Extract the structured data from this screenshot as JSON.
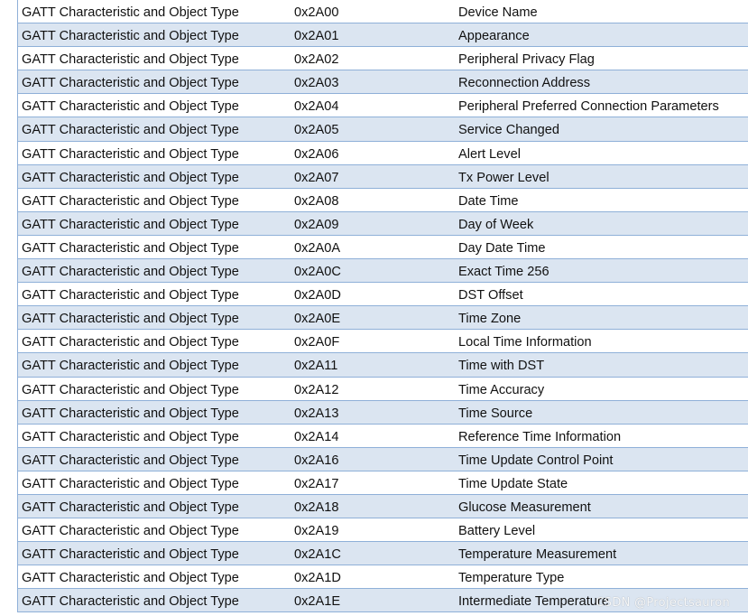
{
  "table": {
    "rows": [
      {
        "type": "GATT Characteristic and Object Type",
        "uuid": "0x2A00",
        "name": "Device Name"
      },
      {
        "type": "GATT Characteristic and Object Type",
        "uuid": "0x2A01",
        "name": "Appearance"
      },
      {
        "type": "GATT Characteristic and Object Type",
        "uuid": "0x2A02",
        "name": "Peripheral Privacy Flag"
      },
      {
        "type": "GATT Characteristic and Object Type",
        "uuid": "0x2A03",
        "name": "Reconnection Address"
      },
      {
        "type": "GATT Characteristic and Object Type",
        "uuid": "0x2A04",
        "name": "Peripheral Preferred Connection Parameters"
      },
      {
        "type": "GATT Characteristic and Object Type",
        "uuid": "0x2A05",
        "name": "Service Changed"
      },
      {
        "type": "GATT Characteristic and Object Type",
        "uuid": "0x2A06",
        "name": "Alert Level"
      },
      {
        "type": "GATT Characteristic and Object Type",
        "uuid": "0x2A07",
        "name": "Tx Power Level"
      },
      {
        "type": "GATT Characteristic and Object Type",
        "uuid": "0x2A08",
        "name": "Date Time"
      },
      {
        "type": "GATT Characteristic and Object Type",
        "uuid": "0x2A09",
        "name": "Day of Week"
      },
      {
        "type": "GATT Characteristic and Object Type",
        "uuid": "0x2A0A",
        "name": "Day Date Time"
      },
      {
        "type": "GATT Characteristic and Object Type",
        "uuid": "0x2A0C",
        "name": "Exact Time 256"
      },
      {
        "type": "GATT Characteristic and Object Type",
        "uuid": "0x2A0D",
        "name": "DST Offset"
      },
      {
        "type": "GATT Characteristic and Object Type",
        "uuid": "0x2A0E",
        "name": "Time Zone"
      },
      {
        "type": "GATT Characteristic and Object Type",
        "uuid": "0x2A0F",
        "name": "Local Time Information"
      },
      {
        "type": "GATT Characteristic and Object Type",
        "uuid": "0x2A11",
        "name": "Time with DST"
      },
      {
        "type": "GATT Characteristic and Object Type",
        "uuid": "0x2A12",
        "name": "Time Accuracy"
      },
      {
        "type": "GATT Characteristic and Object Type",
        "uuid": "0x2A13",
        "name": "Time Source"
      },
      {
        "type": "GATT Characteristic and Object Type",
        "uuid": "0x2A14",
        "name": "Reference Time Information"
      },
      {
        "type": "GATT Characteristic and Object Type",
        "uuid": "0x2A16",
        "name": "Time Update Control Point"
      },
      {
        "type": "GATT Characteristic and Object Type",
        "uuid": "0x2A17",
        "name": "Time Update State"
      },
      {
        "type": "GATT Characteristic and Object Type",
        "uuid": "0x2A18",
        "name": "Glucose Measurement"
      },
      {
        "type": "GATT Characteristic and Object Type",
        "uuid": "0x2A19",
        "name": "Battery Level"
      },
      {
        "type": "GATT Characteristic and Object Type",
        "uuid": "0x2A1C",
        "name": "Temperature Measurement"
      },
      {
        "type": "GATT Characteristic and Object Type",
        "uuid": "0x2A1D",
        "name": "Temperature Type"
      },
      {
        "type": "GATT Characteristic and Object Type",
        "uuid": "0x2A1E",
        "name": "Intermediate Temperature"
      }
    ]
  },
  "watermark": "CSDN @Projectsauron",
  "colors": {
    "row_shaded": "#dbe5f1",
    "row_plain": "#ffffff",
    "border": "#8fb0d8"
  }
}
